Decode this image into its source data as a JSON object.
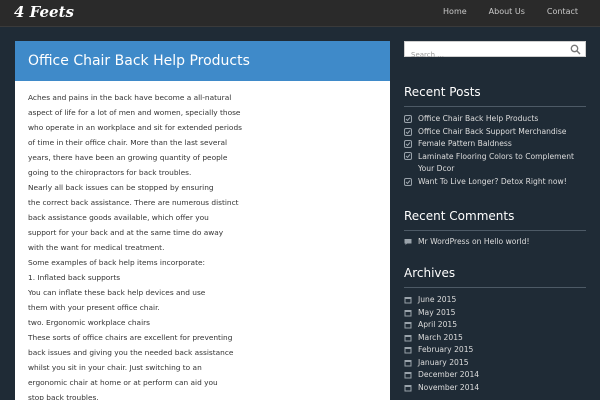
{
  "site": {
    "title": "4 Feets"
  },
  "nav": {
    "home": "Home",
    "about": "About Us",
    "contact": "Contact"
  },
  "post": {
    "title": "Office Chair Back Help Products",
    "lines": [
      "Aches and pains in the back have become a all-natural",
      "aspect of life for a lot of men and women, specially those",
      "who operate in an workplace and sit for extended periods",
      "of time in their office chair. More than the last several",
      "years, there have been an growing quantity of people",
      "going to the chiropractors for back troubles.",
      "Nearly all back issues can be stopped by ensuring",
      "the correct back assistance. There are numerous distinct",
      "back assistance goods available, which offer you",
      "support for your back and at the same time do away",
      "with the want for medical treatment.",
      "Some examples of back help items incorporate:",
      "1. Inflated back supports",
      "You can inflate these back help devices and use",
      "them with your present office chair.",
      "two. Ergonomic workplace chairs",
      "These sorts of office chairs are excellent for preventing",
      "back issues and giving you the needed back assistance",
      "whilst you sit in your chair. Just switching to an",
      "ergonomic chair at home or at perform can aid you",
      "stop back troubles."
    ]
  },
  "search": {
    "placeholder": "Search ..."
  },
  "recent_posts": {
    "title": "Recent Posts",
    "items": [
      "Office Chair Back Help Products",
      "Office Chair Back Support Merchandise",
      "Female Pattern Baldness",
      "Laminate Flooring Colors to Complement Your Dcor",
      "Want To Live Longer? Detox Right now!"
    ]
  },
  "recent_comments": {
    "title": "Recent Comments",
    "author": "Mr WordPress",
    "on": "on",
    "post": "Hello world!"
  },
  "archives": {
    "title": "Archives",
    "items": [
      "June 2015",
      "May 2015",
      "April 2015",
      "March 2015",
      "February 2015",
      "January 2015",
      "December 2014",
      "November 2014"
    ]
  },
  "colors": {
    "accent": "#3f8ac9",
    "background": "#1f2b36",
    "topbar": "#2a2a2a",
    "icon": "#9aa3ab"
  }
}
